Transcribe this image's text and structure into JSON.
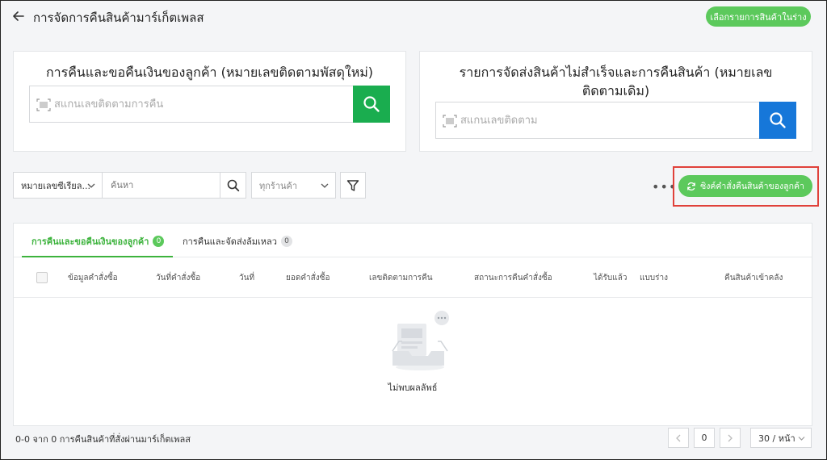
{
  "header": {
    "title": "การจัดการคืนสินค้ามาร์เก็ตเพลส",
    "draft_button": "เลือกรายการสินค้าในร่าง"
  },
  "return_card": {
    "title": "การคืนและขอคืนเงินของลูกค้า (หมายเลขติดตามพัสดุใหม่)",
    "placeholder": "สแกนเลขติดตามการคืน",
    "button_color": "#1aad4f"
  },
  "failed_card": {
    "title": "รายการจัดส่งสินค้าไม่สำเร็จและการคืนสินค้า (หมายเลขติดตามเดิม)",
    "placeholder": "สแกนเลขติดตาม",
    "button_color": "#1677d9"
  },
  "filters": {
    "type_select": "หมายเลขซีเรียล...",
    "search_placeholder": "ค้นหา",
    "shop_select": "ทุกร้านค้า",
    "more": "•••",
    "sync_button": "ซิงค์คำสั่งคืนสินค้าของลูกค้า"
  },
  "tabs": [
    {
      "label": "การคืนและขอคืนเงินของลูกค้า",
      "count": "0"
    },
    {
      "label": "การคืนและจัดส่งล้มเหลว",
      "count": "0"
    }
  ],
  "columns": [
    "ข้อมูลคำสั่งซื้อ",
    "วันที่คำสั่งซื้อ",
    "วันที่",
    "ยอดคำสั่งซื้อ",
    "เลขติดตามการคืน",
    "สถานะการคืนคำสั่งซื้อ",
    "ได้รับแล้ว",
    "แบบร่าง",
    "คืนสินค้าเข้าคลัง"
  ],
  "empty": {
    "text": "ไม่พบผลลัพธ์"
  },
  "footer": {
    "summary": "0-0 จาก 0 การคืนสินค้าที่สั่งผ่านมาร์เก็ตเพลส",
    "page": "0",
    "page_size": "30 / หน้า"
  },
  "colors": {
    "accent": "#5cc95c",
    "highlight": "#e0413a"
  }
}
